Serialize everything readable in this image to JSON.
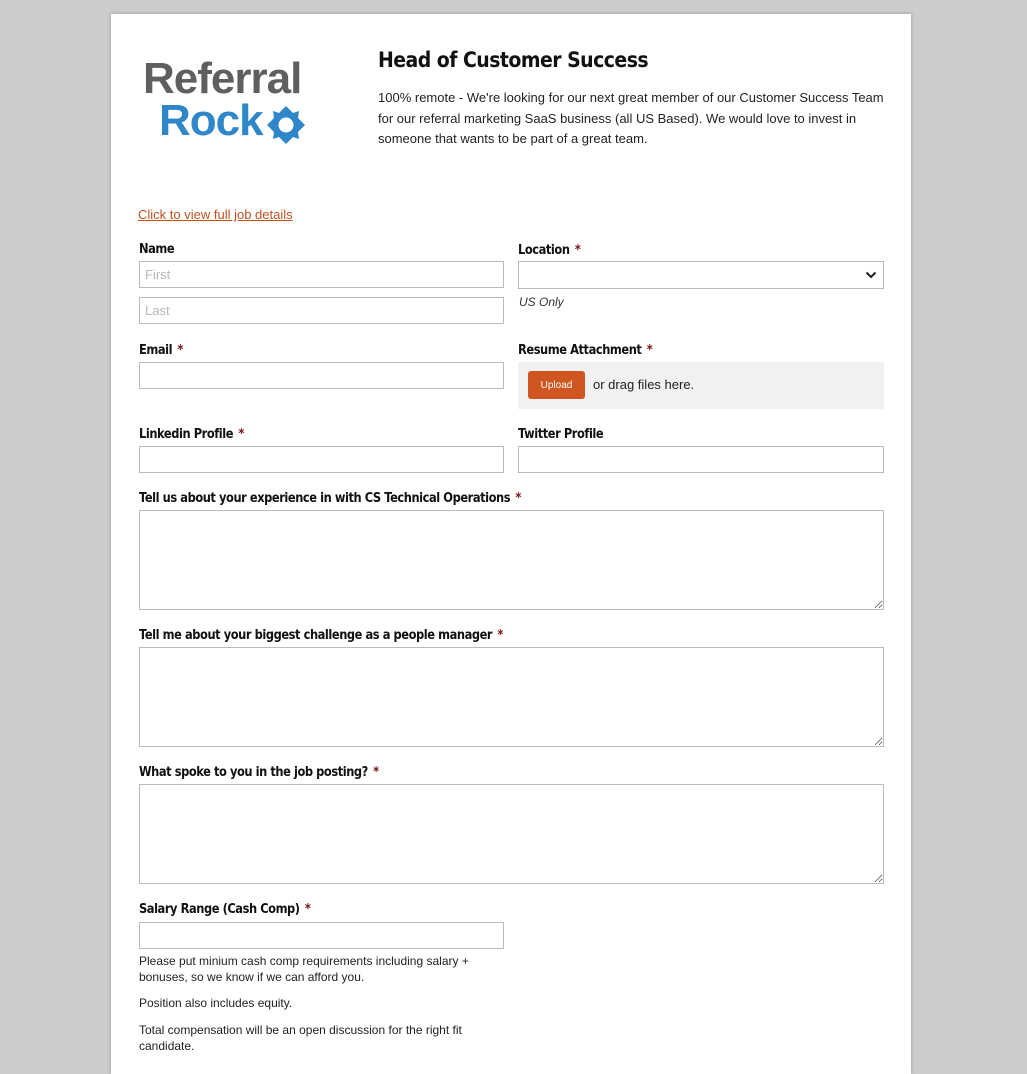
{
  "logo": {
    "line1": "Referral",
    "line2": "Rock"
  },
  "job": {
    "title": "Head of Customer Success",
    "summary": "100% remote - We're looking for our next great member of our Customer Success Team for our referral marketing SaaS business (all US Based). We would love to invest in someone that wants to be part of a great team."
  },
  "details_link": "Click to view full job details",
  "required_marker": "*",
  "fields": {
    "name": {
      "label": "Name",
      "first_placeholder": "First",
      "last_placeholder": "Last"
    },
    "location": {
      "label": "Location",
      "value": "",
      "hint": "US Only"
    },
    "email": {
      "label": "Email",
      "value": ""
    },
    "resume": {
      "label": "Resume Attachment",
      "button": "Upload",
      "drag_text": "or drag files here."
    },
    "linkedin": {
      "label": "Linkedin Profile",
      "value": ""
    },
    "twitter": {
      "label": "Twitter Profile",
      "value": ""
    },
    "q_experience": {
      "label": "Tell us about your experience in with CS Technical Operations"
    },
    "q_challenge": {
      "label": "Tell me about your biggest challenge as a people manager"
    },
    "q_spoke": {
      "label": "What spoke to you in the job posting?"
    },
    "salary": {
      "label": "Salary Range (Cash Comp)",
      "value": "",
      "notes": [
        "Please put minium cash comp requirements including salary + bonuses, so we know if we can afford you.",
        "Position also includes equity.",
        "Total compensation will be an open discussion for the right fit candidate."
      ]
    }
  },
  "colors": {
    "accent": "#cf5620",
    "link": "#c0521f",
    "logo_gray": "#5f5f5f",
    "logo_blue": "#2f86c9",
    "required": "#7a0f0f"
  },
  "icons": {
    "location_dropdown": "chevron-down-icon",
    "logo_mark": "gear-icon"
  }
}
